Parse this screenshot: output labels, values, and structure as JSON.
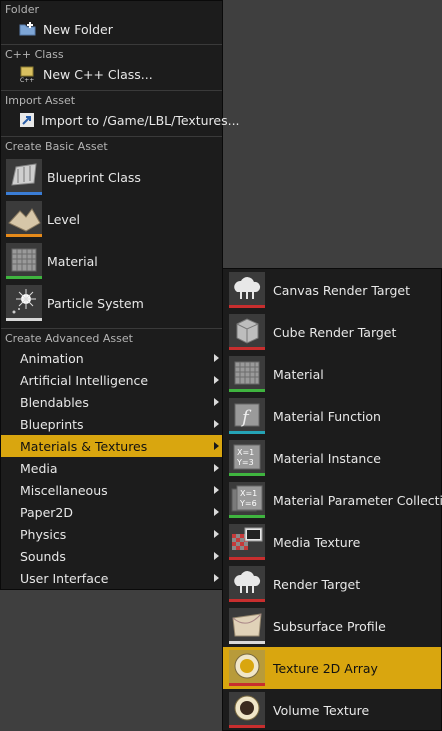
{
  "main_menu": {
    "sections": {
      "folder": "Folder",
      "cpp": "C++ Class",
      "import": "Import Asset",
      "basic": "Create Basic Asset",
      "advanced": "Create Advanced Asset"
    },
    "new_folder": "New Folder",
    "new_cpp": "New C++ Class...",
    "import_to": "Import to /Game/LBL/Textures...",
    "basic_items": [
      {
        "label": "Blueprint Class",
        "icon": "blueprint-class-icon",
        "color": "#3a7dd6"
      },
      {
        "label": "Level",
        "icon": "level-icon",
        "color": "#e68a1a"
      },
      {
        "label": "Material",
        "icon": "material-icon",
        "color": "#3fb43f"
      },
      {
        "label": "Particle System",
        "icon": "particle-system-icon",
        "color": "#d8d8d8"
      }
    ],
    "advanced_items": [
      {
        "label": "Animation"
      },
      {
        "label": "Artificial Intelligence"
      },
      {
        "label": "Blendables"
      },
      {
        "label": "Blueprints"
      },
      {
        "label": "Materials & Textures"
      },
      {
        "label": "Media"
      },
      {
        "label": "Miscellaneous"
      },
      {
        "label": "Paper2D"
      },
      {
        "label": "Physics"
      },
      {
        "label": "Sounds"
      },
      {
        "label": "User Interface"
      }
    ],
    "selected_category": "Materials & Textures"
  },
  "submenu": {
    "items": [
      {
        "label": "Canvas Render Target",
        "icon": "canvas-render-target-icon",
        "color": "#c82e2e"
      },
      {
        "label": "Cube Render Target",
        "icon": "cube-render-target-icon",
        "color": "#c82e2e"
      },
      {
        "label": "Material",
        "icon": "material-icon",
        "color": "#3fb43f"
      },
      {
        "label": "Material Function",
        "icon": "material-function-icon",
        "color": "#25a3b5"
      },
      {
        "label": "Material Instance",
        "icon": "material-instance-icon",
        "color": "#3fb43f"
      },
      {
        "label": "Material Parameter Collection",
        "icon": "material-parameter-collection-icon",
        "color": "#3fb43f"
      },
      {
        "label": "Media Texture",
        "icon": "media-texture-icon",
        "color": "#c82e2e"
      },
      {
        "label": "Render Target",
        "icon": "render-target-icon",
        "color": "#c82e2e"
      },
      {
        "label": "Subsurface Profile",
        "icon": "subsurface-profile-icon",
        "color": "#d8d8d8"
      },
      {
        "label": "Texture 2D Array",
        "icon": "texture-2d-array-icon",
        "color": "#c82e2e"
      },
      {
        "label": "Volume Texture",
        "icon": "volume-texture-icon",
        "color": "#c82e2e"
      }
    ],
    "selected_item": "Texture 2D Array"
  }
}
